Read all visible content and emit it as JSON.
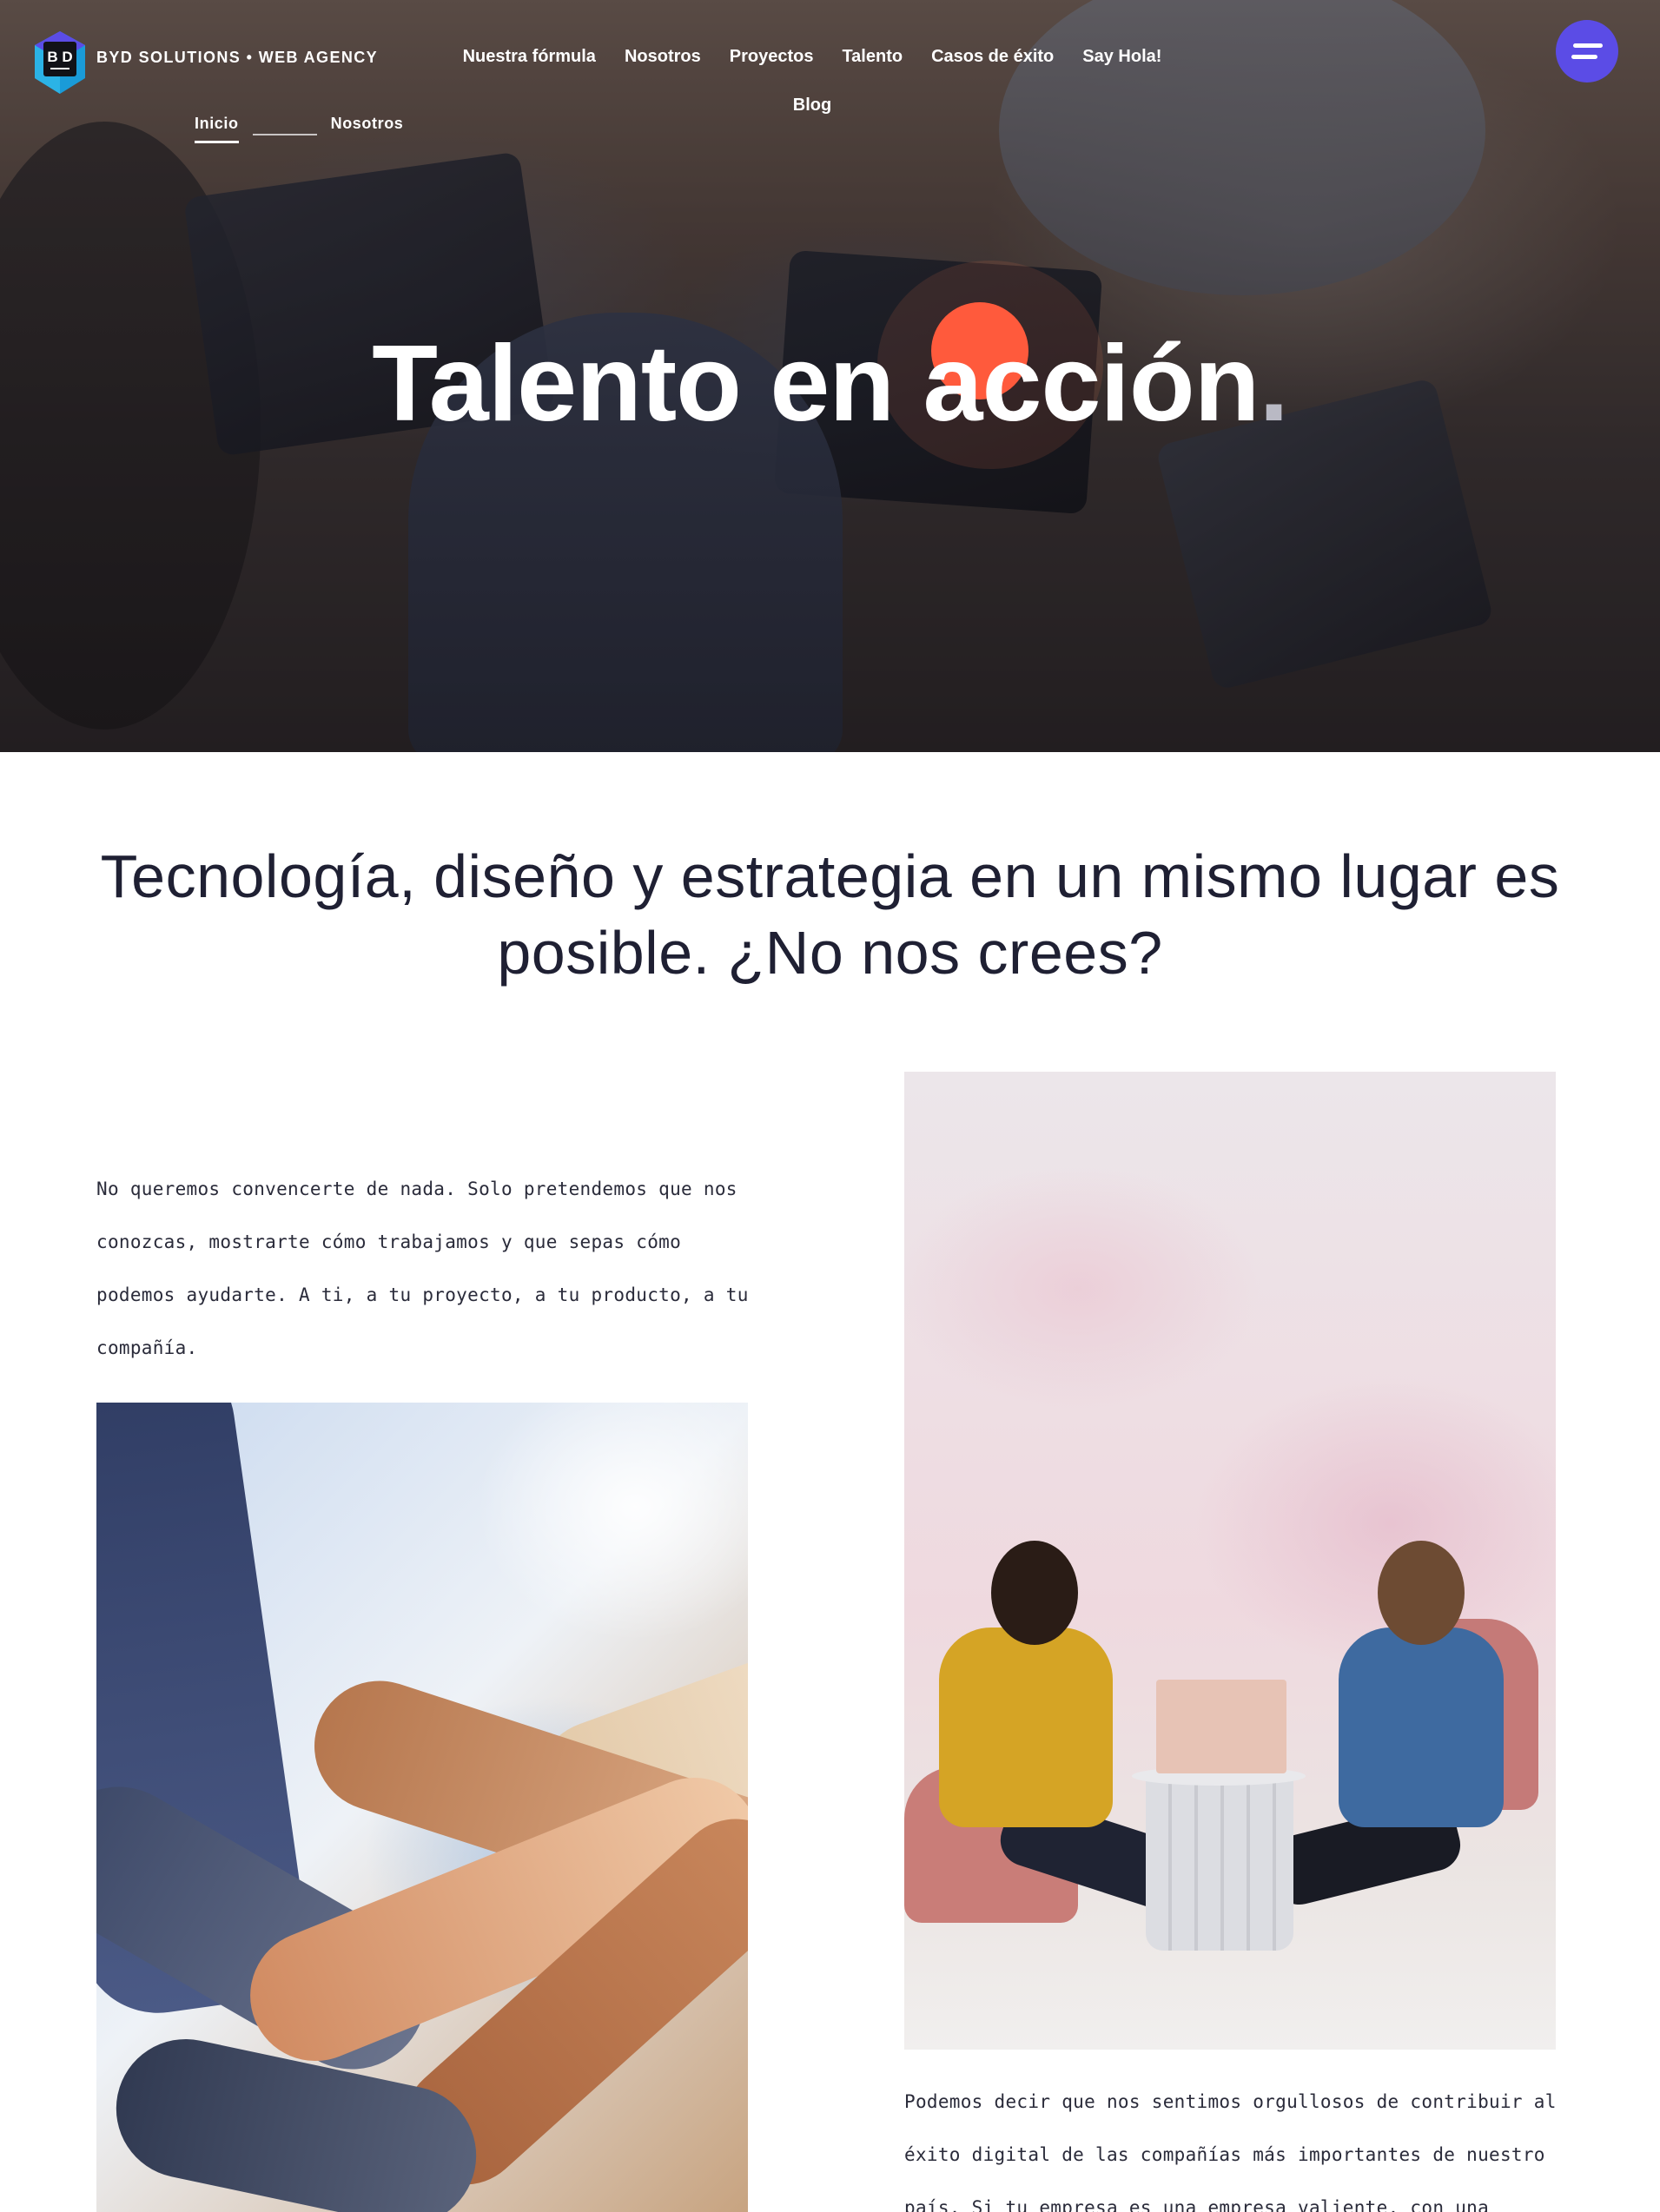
{
  "header": {
    "brand": "BYD SOLUTIONS • WEB AGENCY",
    "nav": [
      {
        "label": "Nuestra fórmula"
      },
      {
        "label": "Nosotros"
      },
      {
        "label": "Proyectos"
      },
      {
        "label": "Talento"
      },
      {
        "label": "Casos de éxito"
      },
      {
        "label": "Say Hola!"
      },
      {
        "label": "Blog"
      }
    ],
    "menu_icon": "hamburger-icon"
  },
  "breadcrumb": {
    "items": [
      {
        "label": "Inicio",
        "active": true
      },
      {
        "label": "Nosotros",
        "active": false
      }
    ]
  },
  "hero": {
    "title": "Talento en acción",
    "title_suffix": ".",
    "accent_color": "#ff5a3c"
  },
  "intro": {
    "heading": "Tecnología, diseño y estrategia en un mismo lugar es posible. ¿No nos crees?"
  },
  "content": {
    "paragraph_left": "No queremos convencerte de nada. Solo pretendemos que nos conozcas, mostrarte cómo trabajamos y que sepas cómo podemos ayudarte. A ti, a tu proyecto, a tu producto, a tu compañía.",
    "paragraph_right": "Podemos decir que nos sentimos orgullosos de contribuir al éxito digital de las compañías más importantes de nuestro país. Si tu empresa es una empresa valiente, con una visión"
  },
  "colors": {
    "menu_button": "#5b4ce6",
    "heading_text": "#1f2033"
  }
}
